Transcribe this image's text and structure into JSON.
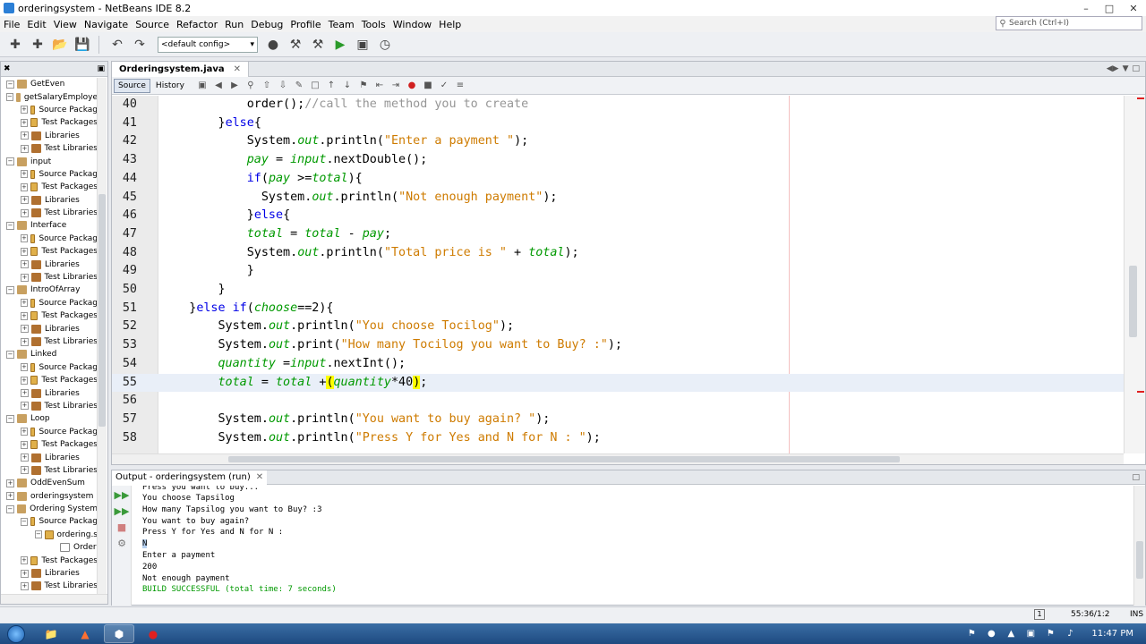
{
  "window": {
    "title": "orderingsystem - NetBeans IDE 8.2"
  },
  "menu": [
    "File",
    "Edit",
    "View",
    "Navigate",
    "Source",
    "Refactor",
    "Run",
    "Debug",
    "Profile",
    "Team",
    "Tools",
    "Window",
    "Help"
  ],
  "search": {
    "placeholder": "Search (Ctrl+I)"
  },
  "toolbar": {
    "config": "<default config>"
  },
  "tree": [
    {
      "label": "GetEven",
      "level": 0,
      "type": "proj",
      "exp": "−"
    },
    {
      "label": "getSalaryEmploye",
      "level": 0,
      "type": "proj",
      "exp": "−"
    },
    {
      "label": "Source Packag",
      "level": 1,
      "type": "pkg",
      "exp": "+"
    },
    {
      "label": "Test Packages",
      "level": 1,
      "type": "pkg",
      "exp": "+"
    },
    {
      "label": "Libraries",
      "level": 1,
      "type": "lib",
      "exp": "+"
    },
    {
      "label": "Test Libraries",
      "level": 1,
      "type": "lib",
      "exp": "+"
    },
    {
      "label": "input",
      "level": 0,
      "type": "proj",
      "exp": "−"
    },
    {
      "label": "Source Packag",
      "level": 1,
      "type": "pkg",
      "exp": "+"
    },
    {
      "label": "Test Packages",
      "level": 1,
      "type": "pkg",
      "exp": "+"
    },
    {
      "label": "Libraries",
      "level": 1,
      "type": "lib",
      "exp": "+"
    },
    {
      "label": "Test Libraries",
      "level": 1,
      "type": "lib",
      "exp": "+"
    },
    {
      "label": "Interface",
      "level": 0,
      "type": "proj",
      "exp": "−"
    },
    {
      "label": "Source Packag",
      "level": 1,
      "type": "pkg",
      "exp": "+"
    },
    {
      "label": "Test Packages",
      "level": 1,
      "type": "pkg",
      "exp": "+"
    },
    {
      "label": "Libraries",
      "level": 1,
      "type": "lib",
      "exp": "+"
    },
    {
      "label": "Test Libraries",
      "level": 1,
      "type": "lib",
      "exp": "+"
    },
    {
      "label": "IntroOfArray",
      "level": 0,
      "type": "proj",
      "exp": "−"
    },
    {
      "label": "Source Packag",
      "level": 1,
      "type": "pkg",
      "exp": "+"
    },
    {
      "label": "Test Packages",
      "level": 1,
      "type": "pkg",
      "exp": "+"
    },
    {
      "label": "Libraries",
      "level": 1,
      "type": "lib",
      "exp": "+"
    },
    {
      "label": "Test Libraries",
      "level": 1,
      "type": "lib",
      "exp": "+"
    },
    {
      "label": "Linked",
      "level": 0,
      "type": "proj",
      "exp": "−"
    },
    {
      "label": "Source Packag",
      "level": 1,
      "type": "pkg",
      "exp": "+"
    },
    {
      "label": "Test Packages",
      "level": 1,
      "type": "pkg",
      "exp": "+"
    },
    {
      "label": "Libraries",
      "level": 1,
      "type": "lib",
      "exp": "+"
    },
    {
      "label": "Test Libraries",
      "level": 1,
      "type": "lib",
      "exp": "+"
    },
    {
      "label": "Loop",
      "level": 0,
      "type": "proj",
      "exp": "−"
    },
    {
      "label": "Source Packag",
      "level": 1,
      "type": "pkg",
      "exp": "+"
    },
    {
      "label": "Test Packages",
      "level": 1,
      "type": "pkg",
      "exp": "+"
    },
    {
      "label": "Libraries",
      "level": 1,
      "type": "lib",
      "exp": "+"
    },
    {
      "label": "Test Libraries",
      "level": 1,
      "type": "lib",
      "exp": "+"
    },
    {
      "label": "OddEvenSum",
      "level": 0,
      "type": "proj",
      "exp": "+"
    },
    {
      "label": "orderingsystem",
      "level": 0,
      "type": "proj",
      "exp": "+"
    },
    {
      "label": "Ordering System",
      "level": 0,
      "type": "proj",
      "exp": "−"
    },
    {
      "label": "Source Packag",
      "level": 1,
      "type": "pkg",
      "exp": "−"
    },
    {
      "label": "ordering.s",
      "level": 2,
      "type": "pkg",
      "exp": "−"
    },
    {
      "label": "Order",
      "level": 3,
      "type": "file",
      "exp": ""
    },
    {
      "label": "Test Packages",
      "level": 1,
      "type": "pkg",
      "exp": "+"
    },
    {
      "label": "Libraries",
      "level": 1,
      "type": "lib",
      "exp": "+"
    },
    {
      "label": "Test Libraries",
      "level": 1,
      "type": "lib",
      "exp": "+"
    }
  ],
  "editor": {
    "tab": "Orderingsystem.java",
    "source_label": "Source",
    "history_label": "History",
    "lines": [
      {
        "n": "40",
        "html": "            order();<span class=\"cm\">//call the method you to create</span>"
      },
      {
        "n": "41",
        "html": "        }<span class=\"kw\">else</span>{"
      },
      {
        "n": "42",
        "html": "            System.<span class=\"fld\">out</span>.println(<span class=\"str\">\"Enter a payment \"</span>);"
      },
      {
        "n": "43",
        "html": "            <span class=\"it\">pay</span> = <span class=\"it\">input</span>.nextDouble();"
      },
      {
        "n": "44",
        "html": "            <span class=\"kw\">if</span>(<span class=\"it\">pay</span> &gt;=<span class=\"it\">total</span>){"
      },
      {
        "n": "45",
        "html": "              System.<span class=\"fld\">out</span>.println(<span class=\"str\">\"Not enough payment\"</span>);"
      },
      {
        "n": "46",
        "html": "            }<span class=\"kw\">else</span>{"
      },
      {
        "n": "47",
        "html": "            <span class=\"it\">total</span> = <span class=\"it\">total</span> - <span class=\"it\">pay</span>;"
      },
      {
        "n": "48",
        "html": "            System.<span class=\"fld\">out</span>.println(<span class=\"str\">\"Total price is \"</span> + <span class=\"it\">total</span>);"
      },
      {
        "n": "49",
        "html": "            }"
      },
      {
        "n": "50",
        "html": "        }"
      },
      {
        "n": "51",
        "html": "    }<span class=\"kw\">else if</span>(<span class=\"it\">choose</span>==2){"
      },
      {
        "n": "52",
        "html": "        System.<span class=\"fld\">out</span>.println(<span class=\"str\">\"You choose Tocilog\"</span>);"
      },
      {
        "n": "53",
        "html": "        System.<span class=\"fld\">out</span>.print(<span class=\"str\">\"How many Tocilog you want to Buy? :\"</span>);"
      },
      {
        "n": "54",
        "html": "        <span class=\"it\">quantity</span> =<span class=\"it\">input</span>.nextInt();"
      },
      {
        "n": "55",
        "html": "        <span class=\"it\">total</span> = <span class=\"it\">total</span> +<span class=\"hl\">(</span><span class=\"it\">quantity</span>*40<span class=\"hl\">)</span>;",
        "current": true
      },
      {
        "n": "56",
        "html": ""
      },
      {
        "n": "57",
        "html": "        System.<span class=\"fld\">out</span>.println(<span class=\"str\">\"You want to buy again? \"</span>);"
      },
      {
        "n": "58",
        "html": "        System.<span class=\"fld\">out</span>.println(<span class=\"str\">\"Press Y for Yes and N for N : \"</span>);"
      }
    ]
  },
  "output": {
    "tab": "Output - orderingsystem (run)",
    "lines": [
      {
        "text": "Press you want to buy...",
        "cls": "cut"
      },
      {
        "text": "You choose Tapsilog"
      },
      {
        "text": "How many Tapsilog you want to Buy? :3"
      },
      {
        "text": "You want to buy again?"
      },
      {
        "text": "Press Y for Yes and N for N :"
      },
      {
        "text": "N",
        "sel": true
      },
      {
        "text": "Enter a payment"
      },
      {
        "text": "200"
      },
      {
        "text": "Not enough payment"
      },
      {
        "text": "BUILD SUCCESSFUL (total time: 7 seconds)",
        "cls": "green"
      }
    ]
  },
  "status": {
    "position": "55:36/1:2",
    "mode": "INS"
  },
  "taskbar": {
    "time": "11:47 PM"
  }
}
